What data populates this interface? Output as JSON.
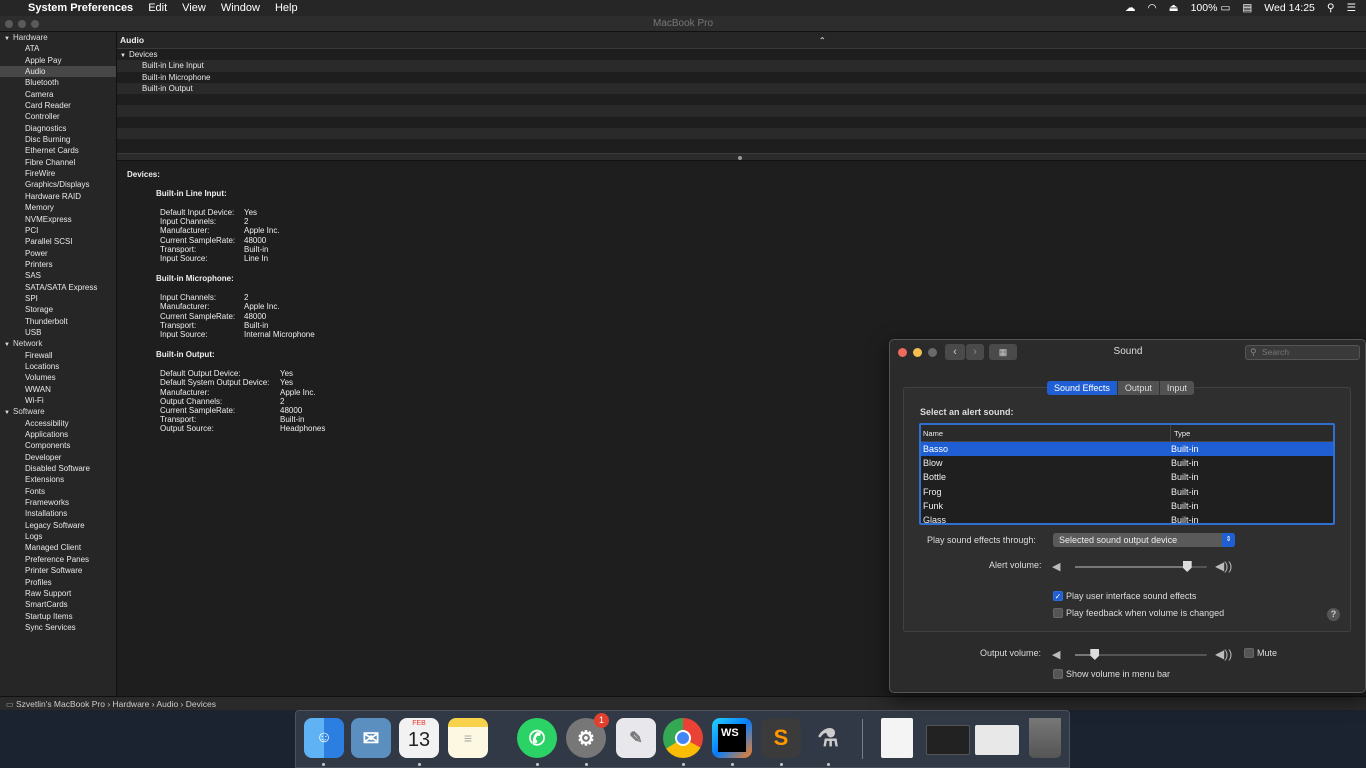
{
  "menubar": {
    "apple": "",
    "app": "System Preferences",
    "items": [
      "Edit",
      "View",
      "Window",
      "Help"
    ],
    "battery": "100%",
    "clock": "Wed 14:25"
  },
  "window": {
    "title": "MacBook Pro"
  },
  "sidebar": {
    "hardware_label": "Hardware",
    "hardware": [
      "ATA",
      "Apple Pay",
      "Audio",
      "Bluetooth",
      "Camera",
      "Card Reader",
      "Controller",
      "Diagnostics",
      "Disc Burning",
      "Ethernet Cards",
      "Fibre Channel",
      "FireWire",
      "Graphics/Displays",
      "Hardware RAID",
      "Memory",
      "NVMExpress",
      "PCI",
      "Parallel SCSI",
      "Power",
      "Printers",
      "SAS",
      "SATA/SATA Express",
      "SPI",
      "Storage",
      "Thunderbolt",
      "USB"
    ],
    "network_label": "Network",
    "network": [
      "Firewall",
      "Locations",
      "Volumes",
      "WWAN",
      "Wi-Fi"
    ],
    "software_label": "Software",
    "software": [
      "Accessibility",
      "Applications",
      "Components",
      "Developer",
      "Disabled Software",
      "Extensions",
      "Fonts",
      "Frameworks",
      "Installations",
      "Legacy Software",
      "Logs",
      "Managed Client",
      "Preference Panes",
      "Printer Software",
      "Profiles",
      "Raw Support",
      "SmartCards",
      "Startup Items",
      "Sync Services"
    ],
    "selected": "Audio"
  },
  "list": {
    "header": "Audio",
    "group": "Devices",
    "items": [
      "Built-in Line Input",
      "Built-in Microphone",
      "Built-in Output"
    ]
  },
  "details": {
    "heading": "Devices:",
    "sections": [
      {
        "title": "Built-in Line Input:",
        "rows": [
          [
            "Default Input Device:",
            "Yes"
          ],
          [
            "Input Channels:",
            "2"
          ],
          [
            "Manufacturer:",
            "Apple Inc."
          ],
          [
            "Current SampleRate:",
            "48000"
          ],
          [
            "Transport:",
            "Built-in"
          ],
          [
            "Input Source:",
            "Line In"
          ]
        ]
      },
      {
        "title": "Built-in Microphone:",
        "rows": [
          [
            "Input Channels:",
            "2"
          ],
          [
            "Manufacturer:",
            "Apple Inc."
          ],
          [
            "Current SampleRate:",
            "48000"
          ],
          [
            "Transport:",
            "Built-in"
          ],
          [
            "Input Source:",
            "Internal Microphone"
          ]
        ]
      },
      {
        "title": "Built-in Output:",
        "rows": [
          [
            "Default Output Device:",
            "Yes"
          ],
          [
            "Default System Output Device:",
            "Yes"
          ],
          [
            "Manufacturer:",
            "Apple Inc."
          ],
          [
            "Output Channels:",
            "2"
          ],
          [
            "Current SampleRate:",
            "48000"
          ],
          [
            "Transport:",
            "Built-in"
          ],
          [
            "Output Source:",
            "Headphones"
          ]
        ]
      }
    ]
  },
  "statusbar": {
    "path": "Szvetlin's MacBook Pro › Hardware › Audio › Devices"
  },
  "sound": {
    "title": "Sound",
    "search_placeholder": "Search",
    "tabs": [
      "Sound Effects",
      "Output",
      "Input"
    ],
    "active_tab": "Sound Effects",
    "select_label": "Select an alert sound:",
    "columns": [
      "Name",
      "Type"
    ],
    "alerts": [
      [
        "Basso",
        "Built-in"
      ],
      [
        "Blow",
        "Built-in"
      ],
      [
        "Bottle",
        "Built-in"
      ],
      [
        "Frog",
        "Built-in"
      ],
      [
        "Funk",
        "Built-in"
      ],
      [
        "Glass",
        "Built-in"
      ]
    ],
    "selected_alert": "Basso",
    "play_through_label": "Play sound effects through:",
    "play_through_value": "Selected sound output device",
    "alert_volume_label": "Alert volume:",
    "alert_volume": 0.85,
    "ui_effects_label": "Play user interface sound effects",
    "ui_effects_checked": true,
    "feedback_label": "Play feedback when volume is changed",
    "feedback_checked": false,
    "output_volume_label": "Output volume:",
    "output_volume": 0.15,
    "mute_label": "Mute",
    "mute_checked": false,
    "show_volume_label": "Show volume in menu bar",
    "show_volume_checked": false
  },
  "dock": {
    "apps": [
      "Finder",
      "Mail",
      "Calendar",
      "Notes",
      "WhatsApp",
      "System Preferences",
      "TextEdit",
      "Chrome",
      "WebStorm",
      "Sublime Text",
      "Instruments"
    ],
    "calendar_month": "FEB",
    "calendar_day": "13",
    "badge": "1",
    "webstorm_label": "WS"
  }
}
